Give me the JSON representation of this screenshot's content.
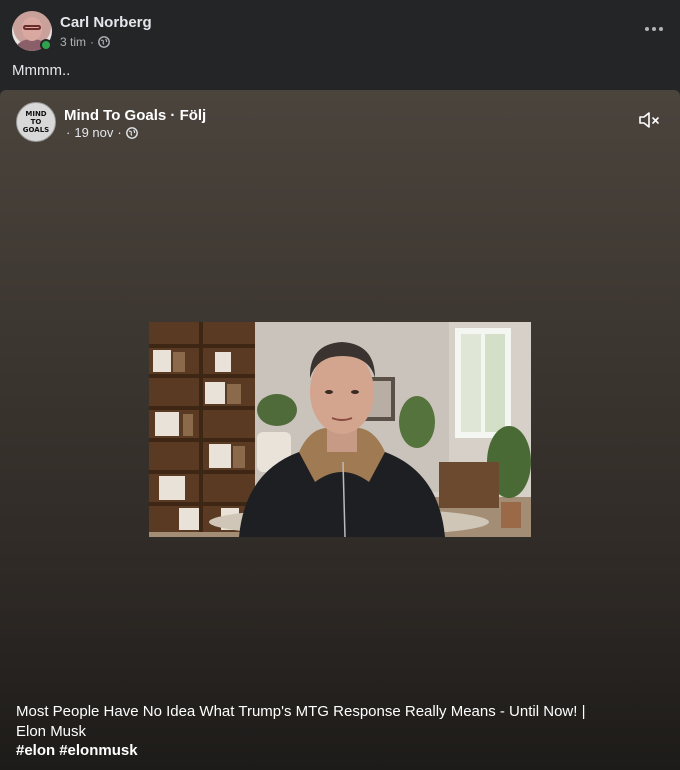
{
  "post": {
    "author": "Carl Norberg",
    "time": "3 tim",
    "separator": "·",
    "text": "Mmmm.."
  },
  "icons": {
    "more": "more-options-icon",
    "audience": "globe-icon",
    "mute": "muted-speaker-icon"
  },
  "shared": {
    "page_avatar_line1": "MIND",
    "page_avatar_line2": "TO GOALS",
    "page_name": "Mind To Goals",
    "follow_sep": "·",
    "follow_label": "Följ",
    "date": "19 nov",
    "caption": "Most People Have No Idea What Trump's MTG Response Really Means - Until Now! | Elon Musk",
    "hashtags": [
      "#elon",
      "#elonmusk"
    ]
  },
  "colors": {
    "background": "#242526",
    "text_primary": "#e4e6eb",
    "text_secondary": "#b0b3b8",
    "online": "#31a24c"
  }
}
